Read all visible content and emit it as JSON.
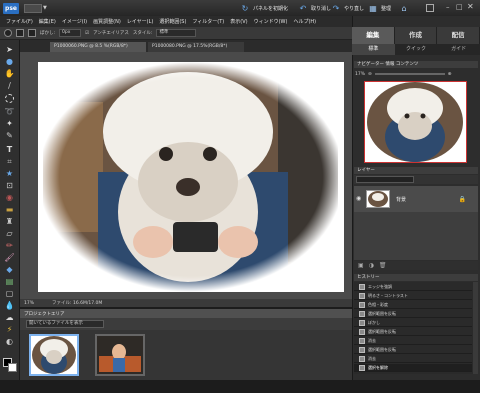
{
  "app": {
    "logo_text": "pse",
    "toolbar": [
      {
        "label": "パネルを初期化",
        "icon": "reset-panels-icon"
      },
      {
        "label": "取り消し",
        "icon": "undo-icon"
      },
      {
        "label": "やり直し",
        "icon": "redo-icon"
      },
      {
        "label": "整理",
        "icon": "organizer-icon"
      },
      {
        "label": "",
        "icon": "home-icon"
      }
    ]
  },
  "menu": [
    "ファイル(F)",
    "編集(E)",
    "イメージ(I)",
    "画質調整(N)",
    "レイヤー(L)",
    "選択範囲(S)",
    "フィルター(T)",
    "表示(V)",
    "ウィンドウ(W)",
    "ヘルプ(H)"
  ],
  "options_bar": {
    "feather_label": "ぼかし:",
    "feather_value": "0px",
    "antialias_label": "アンチエイリアス",
    "style_label": "スタイル:",
    "style_value": "標準"
  },
  "document": {
    "tabs": [
      "P1000060.PNG @ 8.5 %(RGB/8*)",
      "P1000080.PNG @ 17.5%(RGB/8*)"
    ],
    "zoom": "17%",
    "status": "ファイル: 16.6M/17.0M"
  },
  "project_bin": {
    "title": "プロジェクトエリア",
    "filter": "開いているファイルを表示"
  },
  "panel": {
    "tabs": [
      "編集",
      "作成",
      "配信"
    ],
    "active_tab": 0,
    "subtabs": [
      "標準",
      "クイック",
      "ガイド"
    ],
    "active_subtab": 0,
    "navigator": {
      "header": "ナビゲーター  情報  コンテンツ",
      "zoom": "17%"
    },
    "layers": {
      "header": "レイヤー",
      "mode": "",
      "layer_name": "背景"
    },
    "history": {
      "header": "ヒストリー",
      "items": [
        "エッジを強調",
        "明るさ・コントラスト",
        "色相・彩度",
        "選択範囲を反転",
        "ぼかし",
        "選択範囲を反転",
        "消去",
        "選択範囲を反転",
        "消去",
        "選択を解除"
      ],
      "selected": 9
    }
  },
  "colors": {
    "accent": "#2a6fc2",
    "panel_bg": "#2d2d2d",
    "canvas_bg": "#4a4a4a"
  }
}
